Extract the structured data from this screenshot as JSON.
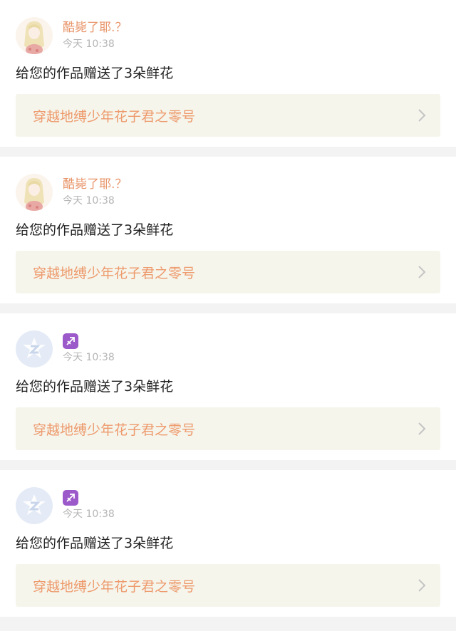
{
  "colors": {
    "username": "#e8956a",
    "work_title": "#ee9a6c",
    "time": "#b5b5b5",
    "link_bg": "#f5f5ec",
    "emoji_badge": "#9b59c9"
  },
  "notifications": [
    {
      "avatar": "anime-girl-avatar",
      "username": "酷毙了耶.？",
      "time": "今天 10:38",
      "message": "给您的作品赠送了3朵鲜花",
      "work_title": "穿越地缚少年花子君之零号"
    },
    {
      "avatar": "anime-girl-avatar",
      "username": "酷毙了耶.？",
      "time": "今天 10:38",
      "message": "给您的作品赠送了3朵鲜花",
      "work_title": "穿越地缚少年花子君之零号"
    },
    {
      "avatar": "default-avatar",
      "username_icon": "sagittarius-emoji-icon",
      "time": "今天 10:38",
      "message": "给您的作品赠送了3朵鲜花",
      "work_title": "穿越地缚少年花子君之零号"
    },
    {
      "avatar": "default-avatar",
      "username_icon": "sagittarius-emoji-icon",
      "time": "今天 10:38",
      "message": "给您的作品赠送了3朵鲜花",
      "work_title": "穿越地缚少年花子君之零号"
    }
  ]
}
